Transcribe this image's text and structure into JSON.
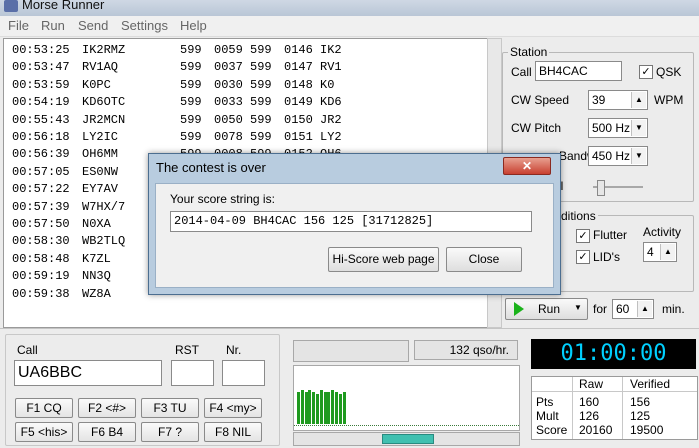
{
  "window": {
    "title": "Morse Runner"
  },
  "menu": [
    "File",
    "Run",
    "Send",
    "Settings",
    "Help"
  ],
  "log": [
    [
      "00:53:25",
      "IK2RMZ",
      "599",
      "0059",
      "599",
      "0146",
      "IK2"
    ],
    [
      "00:53:47",
      "RV1AQ",
      "599",
      "0037",
      "599",
      "0147",
      "RV1"
    ],
    [
      "00:53:59",
      "K0PC",
      "599",
      "0030",
      "599",
      "0148",
      "K0"
    ],
    [
      "00:54:19",
      "KD6OTC",
      "599",
      "0033",
      "599",
      "0149",
      "KD6"
    ],
    [
      "00:55:43",
      "JR2MCN",
      "599",
      "0050",
      "599",
      "0150",
      "JR2"
    ],
    [
      "00:56:18",
      "LY2IC",
      "599",
      "0078",
      "599",
      "0151",
      "LY2"
    ],
    [
      "00:56:39",
      "OH6MM",
      "599",
      "0008",
      "599",
      "0152",
      "OH6"
    ],
    [
      "00:57:05",
      "ES0NW",
      "",
      "",
      "",
      "",
      ""
    ],
    [
      "00:57:22",
      "EY7AV",
      "",
      "",
      "",
      "",
      ""
    ],
    [
      "00:57:39",
      "W7HX/7",
      "",
      "",
      "",
      "",
      ""
    ],
    [
      "00:57:50",
      "N0XA",
      "",
      "",
      "",
      "",
      ""
    ],
    [
      "00:58:30",
      "WB2TLQ",
      "",
      "",
      "",
      "",
      ""
    ],
    [
      "00:58:48",
      "K7ZL",
      "",
      "",
      "",
      "",
      ""
    ],
    [
      "00:59:19",
      "NN3Q",
      "",
      "",
      "",
      "",
      ""
    ],
    [
      "00:59:38",
      "WZ8A",
      "",
      "",
      "",
      "",
      ""
    ]
  ],
  "station": {
    "group_label": "Station",
    "call_label": "Call",
    "call_value": "BH4CAC",
    "qsk_label": "QSK",
    "cw_speed_label": "CW Speed",
    "cw_speed_value": "39",
    "wpm_label": "WPM",
    "cw_pitch_label": "CW Pitch",
    "cw_pitch_value": "500 Hz",
    "bandwidth_label": "RX Bandwidth",
    "bandwidth_label_visible": "Bandwidth",
    "bandwidth_value": "450 Hz",
    "volume_label_visible": "el"
  },
  "conditions": {
    "group_label_visible": "ditions",
    "flutter_label": "Flutter",
    "lids_label": "LID's",
    "activity_label": "Activity",
    "activity_value": "4"
  },
  "run": {
    "run_label": "Run",
    "for_label": "for",
    "minutes_value": "60",
    "min_label": "min."
  },
  "entry": {
    "call_label": "Call",
    "rst_label": "RST",
    "nr_label": "Nr.",
    "call_value": "UA6BBC",
    "rst_value": "",
    "nr_value": ""
  },
  "fkeys": [
    [
      "F1 CQ",
      "F2 <#>",
      "F3 TU",
      "F4 <my>"
    ],
    [
      "F5 <his>",
      "F6 B4",
      "F7 ?",
      "F8 NIL"
    ]
  ],
  "rate": {
    "text": "132 qso/hr."
  },
  "activity_bars": [
    0.8,
    0.85,
    0.8,
    0.85,
    0.8,
    0.75,
    0.85,
    0.8,
    0.8,
    0.85,
    0.8,
    0.75,
    0.8
  ],
  "timer": "01:00:00",
  "score": {
    "headers": [
      "",
      "Raw",
      "Verified"
    ],
    "rows": [
      [
        "Pts",
        "160",
        "156"
      ],
      [
        "Mult",
        "126",
        "125"
      ],
      [
        "Score",
        "20160",
        "19500"
      ]
    ]
  },
  "dialog": {
    "title": "The contest is over",
    "prompt": "Your score string is:",
    "score_string": "2014-04-09 BH4CAC 156 125 [31712825]",
    "hiscore_button": "Hi-Score web page",
    "close_button": "Close"
  }
}
